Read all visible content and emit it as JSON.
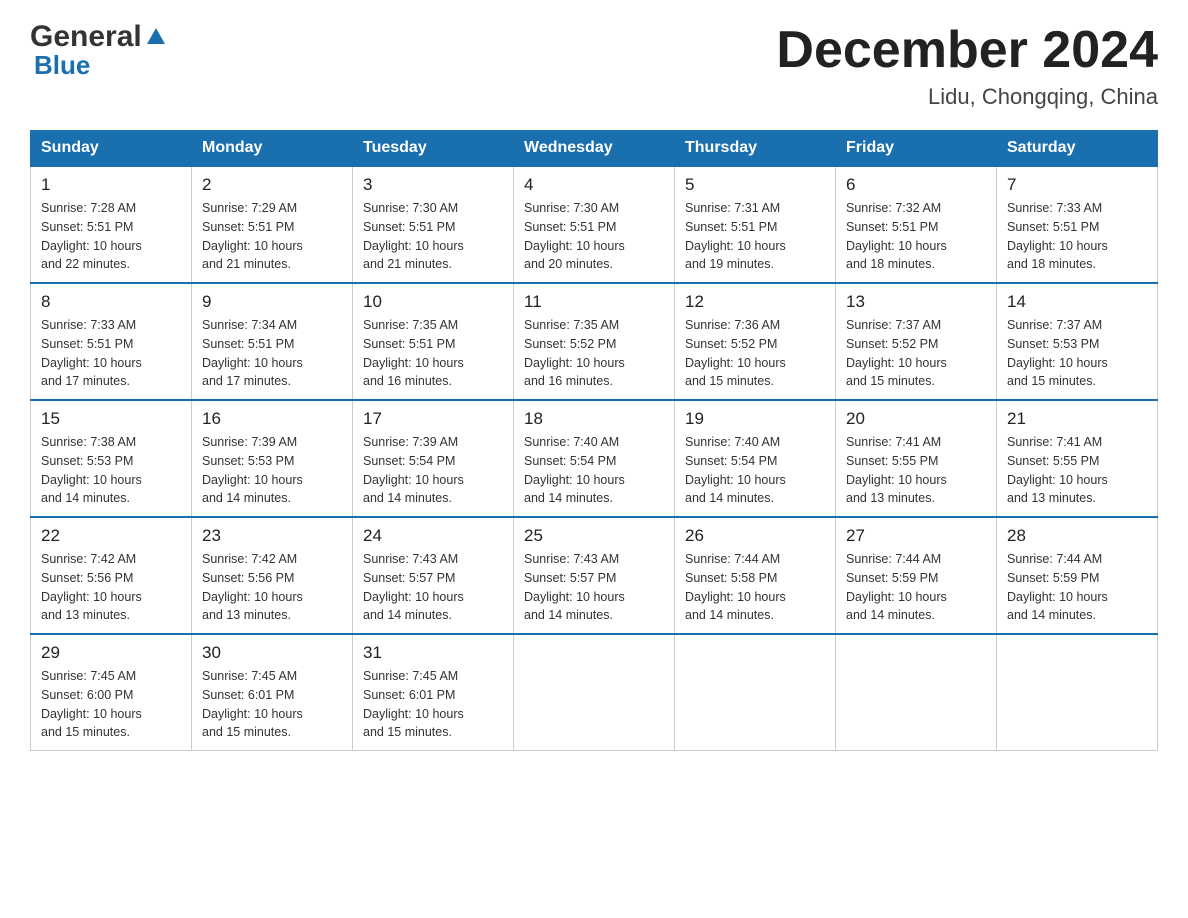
{
  "header": {
    "logo_general": "General",
    "logo_blue": "Blue",
    "title": "December 2024",
    "subtitle": "Lidu, Chongqing, China"
  },
  "weekdays": [
    "Sunday",
    "Monday",
    "Tuesday",
    "Wednesday",
    "Thursday",
    "Friday",
    "Saturday"
  ],
  "weeks": [
    [
      {
        "day": "1",
        "sunrise": "7:28 AM",
        "sunset": "5:51 PM",
        "daylight": "10 hours and 22 minutes."
      },
      {
        "day": "2",
        "sunrise": "7:29 AM",
        "sunset": "5:51 PM",
        "daylight": "10 hours and 21 minutes."
      },
      {
        "day": "3",
        "sunrise": "7:30 AM",
        "sunset": "5:51 PM",
        "daylight": "10 hours and 21 minutes."
      },
      {
        "day": "4",
        "sunrise": "7:30 AM",
        "sunset": "5:51 PM",
        "daylight": "10 hours and 20 minutes."
      },
      {
        "day": "5",
        "sunrise": "7:31 AM",
        "sunset": "5:51 PM",
        "daylight": "10 hours and 19 minutes."
      },
      {
        "day": "6",
        "sunrise": "7:32 AM",
        "sunset": "5:51 PM",
        "daylight": "10 hours and 18 minutes."
      },
      {
        "day": "7",
        "sunrise": "7:33 AM",
        "sunset": "5:51 PM",
        "daylight": "10 hours and 18 minutes."
      }
    ],
    [
      {
        "day": "8",
        "sunrise": "7:33 AM",
        "sunset": "5:51 PM",
        "daylight": "10 hours and 17 minutes."
      },
      {
        "day": "9",
        "sunrise": "7:34 AM",
        "sunset": "5:51 PM",
        "daylight": "10 hours and 17 minutes."
      },
      {
        "day": "10",
        "sunrise": "7:35 AM",
        "sunset": "5:51 PM",
        "daylight": "10 hours and 16 minutes."
      },
      {
        "day": "11",
        "sunrise": "7:35 AM",
        "sunset": "5:52 PM",
        "daylight": "10 hours and 16 minutes."
      },
      {
        "day": "12",
        "sunrise": "7:36 AM",
        "sunset": "5:52 PM",
        "daylight": "10 hours and 15 minutes."
      },
      {
        "day": "13",
        "sunrise": "7:37 AM",
        "sunset": "5:52 PM",
        "daylight": "10 hours and 15 minutes."
      },
      {
        "day": "14",
        "sunrise": "7:37 AM",
        "sunset": "5:53 PM",
        "daylight": "10 hours and 15 minutes."
      }
    ],
    [
      {
        "day": "15",
        "sunrise": "7:38 AM",
        "sunset": "5:53 PM",
        "daylight": "10 hours and 14 minutes."
      },
      {
        "day": "16",
        "sunrise": "7:39 AM",
        "sunset": "5:53 PM",
        "daylight": "10 hours and 14 minutes."
      },
      {
        "day": "17",
        "sunrise": "7:39 AM",
        "sunset": "5:54 PM",
        "daylight": "10 hours and 14 minutes."
      },
      {
        "day": "18",
        "sunrise": "7:40 AM",
        "sunset": "5:54 PM",
        "daylight": "10 hours and 14 minutes."
      },
      {
        "day": "19",
        "sunrise": "7:40 AM",
        "sunset": "5:54 PM",
        "daylight": "10 hours and 14 minutes."
      },
      {
        "day": "20",
        "sunrise": "7:41 AM",
        "sunset": "5:55 PM",
        "daylight": "10 hours and 13 minutes."
      },
      {
        "day": "21",
        "sunrise": "7:41 AM",
        "sunset": "5:55 PM",
        "daylight": "10 hours and 13 minutes."
      }
    ],
    [
      {
        "day": "22",
        "sunrise": "7:42 AM",
        "sunset": "5:56 PM",
        "daylight": "10 hours and 13 minutes."
      },
      {
        "day": "23",
        "sunrise": "7:42 AM",
        "sunset": "5:56 PM",
        "daylight": "10 hours and 13 minutes."
      },
      {
        "day": "24",
        "sunrise": "7:43 AM",
        "sunset": "5:57 PM",
        "daylight": "10 hours and 14 minutes."
      },
      {
        "day": "25",
        "sunrise": "7:43 AM",
        "sunset": "5:57 PM",
        "daylight": "10 hours and 14 minutes."
      },
      {
        "day": "26",
        "sunrise": "7:44 AM",
        "sunset": "5:58 PM",
        "daylight": "10 hours and 14 minutes."
      },
      {
        "day": "27",
        "sunrise": "7:44 AM",
        "sunset": "5:59 PM",
        "daylight": "10 hours and 14 minutes."
      },
      {
        "day": "28",
        "sunrise": "7:44 AM",
        "sunset": "5:59 PM",
        "daylight": "10 hours and 14 minutes."
      }
    ],
    [
      {
        "day": "29",
        "sunrise": "7:45 AM",
        "sunset": "6:00 PM",
        "daylight": "10 hours and 15 minutes."
      },
      {
        "day": "30",
        "sunrise": "7:45 AM",
        "sunset": "6:01 PM",
        "daylight": "10 hours and 15 minutes."
      },
      {
        "day": "31",
        "sunrise": "7:45 AM",
        "sunset": "6:01 PM",
        "daylight": "10 hours and 15 minutes."
      },
      null,
      null,
      null,
      null
    ]
  ],
  "labels": {
    "sunrise": "Sunrise:",
    "sunset": "Sunset:",
    "daylight": "Daylight:"
  }
}
